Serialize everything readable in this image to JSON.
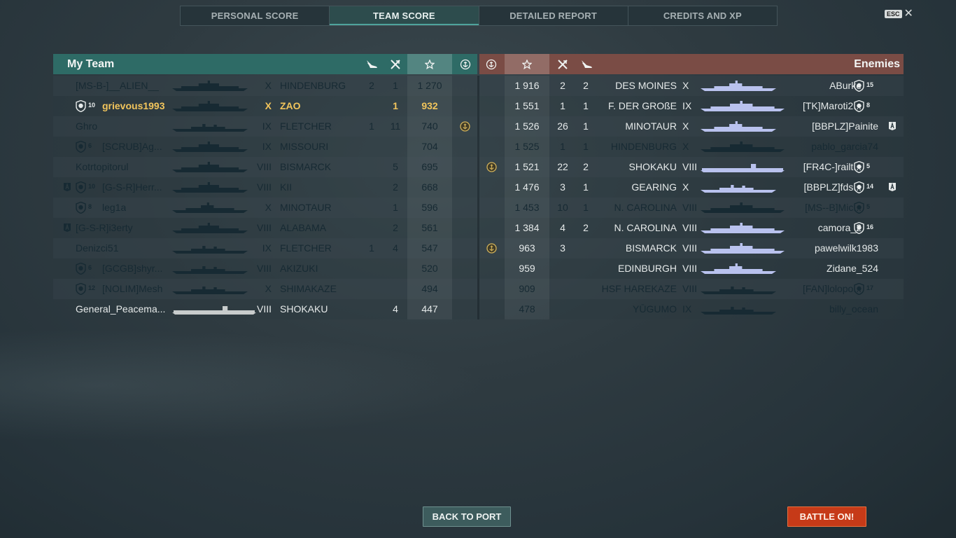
{
  "tabs": [
    {
      "label": "PERSONAL SCORE"
    },
    {
      "label": "TEAM SCORE"
    },
    {
      "label": "DETAILED REPORT"
    },
    {
      "label": "CREDITS AND XP"
    }
  ],
  "active_tab": 1,
  "esc": {
    "key": "ESC",
    "close": "✕"
  },
  "my_team": {
    "title": "My Team",
    "header_icons": [
      "plane-icon",
      "crossed-planes-icon",
      "star-icon",
      "anchor-medal-icon"
    ],
    "rows": [
      {
        "badge": false,
        "rank": "",
        "a_badge": false,
        "player": "[MS-B-]__ALIEN__",
        "ship_shape": "battleship",
        "tier": "X",
        "ship": "HINDENBURG",
        "planes": "2",
        "kills": "1",
        "xp": "1 270",
        "medal": false,
        "state": "dead"
      },
      {
        "badge": true,
        "rank": "10",
        "a_badge": false,
        "player": "grievous1993",
        "ship_shape": "battleship",
        "tier": "X",
        "ship": "ZAO",
        "planes": "",
        "kills": "1",
        "xp": "932",
        "medal": false,
        "state": "me"
      },
      {
        "badge": false,
        "rank": "",
        "a_badge": false,
        "player": "Ghro",
        "ship_shape": "destroyer",
        "tier": "IX",
        "ship": "FLETCHER",
        "planes": "1",
        "kills": "11",
        "xp": "740",
        "medal": true,
        "state": "dead"
      },
      {
        "badge": true,
        "rank": "6",
        "a_badge": false,
        "player": "[SCRUB]Ag...",
        "ship_shape": "battleship",
        "tier": "IX",
        "ship": "MISSOURI",
        "planes": "",
        "kills": "",
        "xp": "704",
        "medal": false,
        "state": "dead"
      },
      {
        "badge": false,
        "rank": "",
        "a_badge": false,
        "player": "Kotrtopitorul",
        "ship_shape": "battleship",
        "tier": "VIII",
        "ship": "BISMARCK",
        "planes": "",
        "kills": "5",
        "xp": "695",
        "medal": false,
        "state": "dead"
      },
      {
        "badge": true,
        "rank": "10",
        "a_badge": true,
        "player": "[G-S-R]Herr...",
        "ship_shape": "battleship",
        "tier": "VIII",
        "ship": "KII",
        "planes": "",
        "kills": "2",
        "xp": "668",
        "medal": false,
        "state": "dead"
      },
      {
        "badge": true,
        "rank": "8",
        "a_badge": false,
        "player": "leg1a",
        "ship_shape": "cruiser",
        "tier": "X",
        "ship": "MINOTAUR",
        "planes": "",
        "kills": "1",
        "xp": "596",
        "medal": false,
        "state": "dead"
      },
      {
        "badge": false,
        "rank": "",
        "a_badge": true,
        "player": "[G-S-R]i3erty",
        "ship_shape": "battleship",
        "tier": "VIII",
        "ship": "ALABAMA",
        "planes": "",
        "kills": "2",
        "xp": "561",
        "medal": false,
        "state": "dead"
      },
      {
        "badge": false,
        "rank": "",
        "a_badge": false,
        "player": "Denizci51",
        "ship_shape": "destroyer",
        "tier": "IX",
        "ship": "FLETCHER",
        "planes": "1",
        "kills": "4",
        "xp": "547",
        "medal": false,
        "state": "dead"
      },
      {
        "badge": true,
        "rank": "6",
        "a_badge": false,
        "player": "[GCGB]shyr...",
        "ship_shape": "destroyer",
        "tier": "VIII",
        "ship": "AKIZUKI",
        "planes": "",
        "kills": "",
        "xp": "520",
        "medal": false,
        "state": "dead"
      },
      {
        "badge": true,
        "rank": "12",
        "a_badge": false,
        "player": "[NOLIM]Mesh",
        "ship_shape": "destroyer",
        "tier": "X",
        "ship": "SHIMAKAZE",
        "planes": "",
        "kills": "",
        "xp": "494",
        "medal": false,
        "state": "dead"
      },
      {
        "badge": false,
        "rank": "",
        "a_badge": false,
        "player": "General_Peacema...",
        "ship_shape": "carrier",
        "tier": "VIII",
        "ship": "SHOKAKU",
        "planes": "",
        "kills": "4",
        "xp": "447",
        "medal": false,
        "state": "alive"
      }
    ]
  },
  "enemies": {
    "title": "Enemies",
    "header_icons": [
      "anchor-medal-icon",
      "star-icon",
      "crossed-planes-icon",
      "plane-icon"
    ],
    "rows": [
      {
        "medal": false,
        "xp": "1 916",
        "kills": "2",
        "planes": "2",
        "ship": "DES MOINES",
        "tier": "X",
        "ship_shape": "cruiser",
        "player": "ABurke",
        "badge": true,
        "rank": "15",
        "a_badge": false,
        "state": "alive"
      },
      {
        "medal": false,
        "xp": "1 551",
        "kills": "1",
        "planes": "1",
        "ship": "F. DER GROßE",
        "tier": "IX",
        "ship_shape": "battleship",
        "player": "[TK]Maroti2...",
        "badge": true,
        "rank": "8",
        "a_badge": false,
        "state": "alive"
      },
      {
        "medal": false,
        "xp": "1 526",
        "kills": "26",
        "planes": "1",
        "ship": "MINOTAUR",
        "tier": "X",
        "ship_shape": "cruiser",
        "player": "[BBPLZ]Painite",
        "badge": false,
        "rank": "",
        "a_badge": true,
        "state": "alive"
      },
      {
        "medal": false,
        "xp": "1 525",
        "kills": "1",
        "planes": "1",
        "ship": "HINDENBURG",
        "tier": "X",
        "ship_shape": "battleship",
        "player": "pablo_garcia74",
        "badge": false,
        "rank": "",
        "a_badge": false,
        "state": "dead"
      },
      {
        "medal": true,
        "xp": "1 521",
        "kills": "22",
        "planes": "2",
        "ship": "SHOKAKU",
        "tier": "VIII",
        "ship_shape": "carrier",
        "player": "[FR4C-]railt...",
        "badge": true,
        "rank": "5",
        "a_badge": false,
        "state": "alive"
      },
      {
        "medal": false,
        "xp": "1 476",
        "kills": "3",
        "planes": "1",
        "ship": "GEARING",
        "tier": "X",
        "ship_shape": "destroyer",
        "player": "[BBPLZ]fds...",
        "badge": true,
        "rank": "14",
        "a_badge": true,
        "state": "alive"
      },
      {
        "medal": false,
        "xp": "1 453",
        "kills": "10",
        "planes": "1",
        "ship": "N. CAROLINA",
        "tier": "VIII",
        "ship_shape": "battleship",
        "player": "[MS--B]Mic...",
        "badge": true,
        "rank": "5",
        "a_badge": false,
        "state": "dead"
      },
      {
        "medal": false,
        "xp": "1 384",
        "kills": "4",
        "planes": "2",
        "ship": "N. CAROLINA",
        "tier": "VIII",
        "ship_shape": "battleship",
        "player": "camora_2",
        "badge": true,
        "rank": "16",
        "a_badge": false,
        "state": "alive"
      },
      {
        "medal": true,
        "xp": "963",
        "kills": "3",
        "planes": "",
        "ship": "BISMARCK",
        "tier": "VIII",
        "ship_shape": "battleship",
        "player": "pawelwilk1983",
        "badge": false,
        "rank": "",
        "a_badge": false,
        "state": "alive"
      },
      {
        "medal": false,
        "xp": "959",
        "kills": "",
        "planes": "",
        "ship": "EDINBURGH",
        "tier": "VIII",
        "ship_shape": "cruiser",
        "player": "Zidane_524",
        "badge": false,
        "rank": "",
        "a_badge": false,
        "state": "alive"
      },
      {
        "medal": false,
        "xp": "909",
        "kills": "",
        "planes": "",
        "ship": "HSF HAREKAZE",
        "tier": "VIII",
        "ship_shape": "destroyer",
        "player": "[FAN]lolopo...",
        "badge": true,
        "rank": "17",
        "a_badge": false,
        "state": "dead"
      },
      {
        "medal": false,
        "xp": "478",
        "kills": "",
        "planes": "",
        "ship": "YŪGUMO",
        "tier": "IX",
        "ship_shape": "destroyer",
        "player": "billy_ocean",
        "badge": false,
        "rank": "",
        "a_badge": false,
        "state": "dead"
      }
    ]
  },
  "buttons": {
    "back_to_port": "BACK TO PORT",
    "battle_on": "BATTLE ON!"
  },
  "colors": {
    "my_team_header": "#2e6b66",
    "enemy_header": "#7a4c45",
    "player_highlight": "#f2c55c",
    "battle_button": "#c63a18",
    "alive_enemy_ship": "#b9c2ee",
    "dead_text": "#172a33"
  }
}
